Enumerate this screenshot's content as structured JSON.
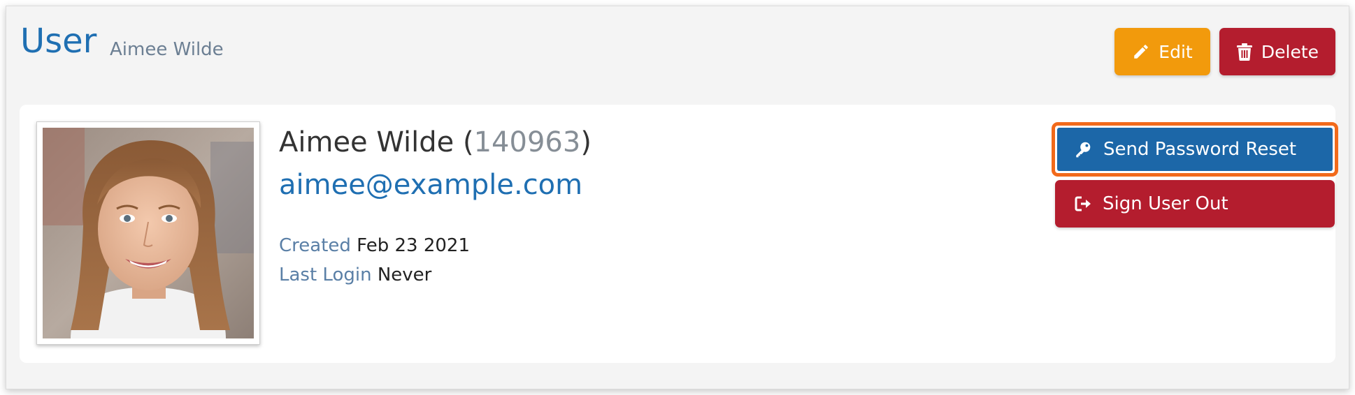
{
  "header": {
    "title": "User",
    "subtitle": "Aimee Wilde",
    "edit_label": "Edit",
    "delete_label": "Delete"
  },
  "profile": {
    "name": "Aimee Wilde",
    "id_open": " (",
    "id": "140963",
    "id_close": ")",
    "email": "aimee@example.com",
    "created_label": "Created",
    "created_value": "Feb 23 2021",
    "last_login_label": "Last Login",
    "last_login_value": "Never"
  },
  "actions": {
    "reset_label": "Send Password Reset",
    "signout_label": "Sign User Out"
  },
  "icons": {
    "edit": "pencil-icon",
    "delete": "trash-icon",
    "reset": "key-icon",
    "signout": "sign-out-icon"
  },
  "colors": {
    "title_blue": "#1f6fb2",
    "edit_orange": "#f29a0c",
    "danger_red": "#b41d2e",
    "primary_blue": "#1c67a8",
    "highlight_orange": "#f26a1b"
  }
}
